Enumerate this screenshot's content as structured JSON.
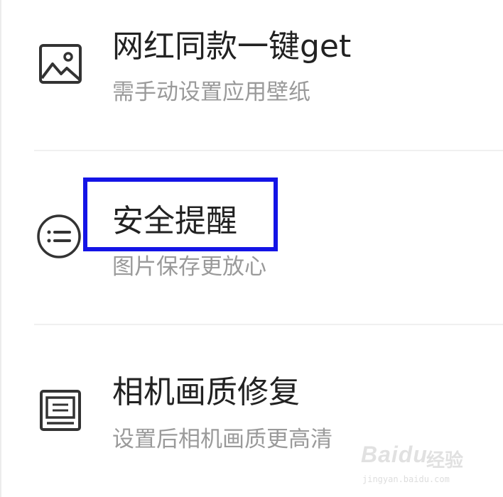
{
  "menu": {
    "items": [
      {
        "icon": "image-icon",
        "title": "网红同款一键get",
        "subtitle": "需手动设置应用壁纸"
      },
      {
        "icon": "list-circle-icon",
        "title": "安全提醒",
        "subtitle": "图片保存更放心"
      },
      {
        "icon": "frame-icon",
        "title": "相机画质修复",
        "subtitle": "设置后相机画质更高清"
      }
    ]
  },
  "annotation": {
    "highlight_color": "#1414e6"
  },
  "watermark": {
    "logo": "Baidu",
    "logo_suffix": "经验",
    "url": "jingyan.baidu.com"
  }
}
